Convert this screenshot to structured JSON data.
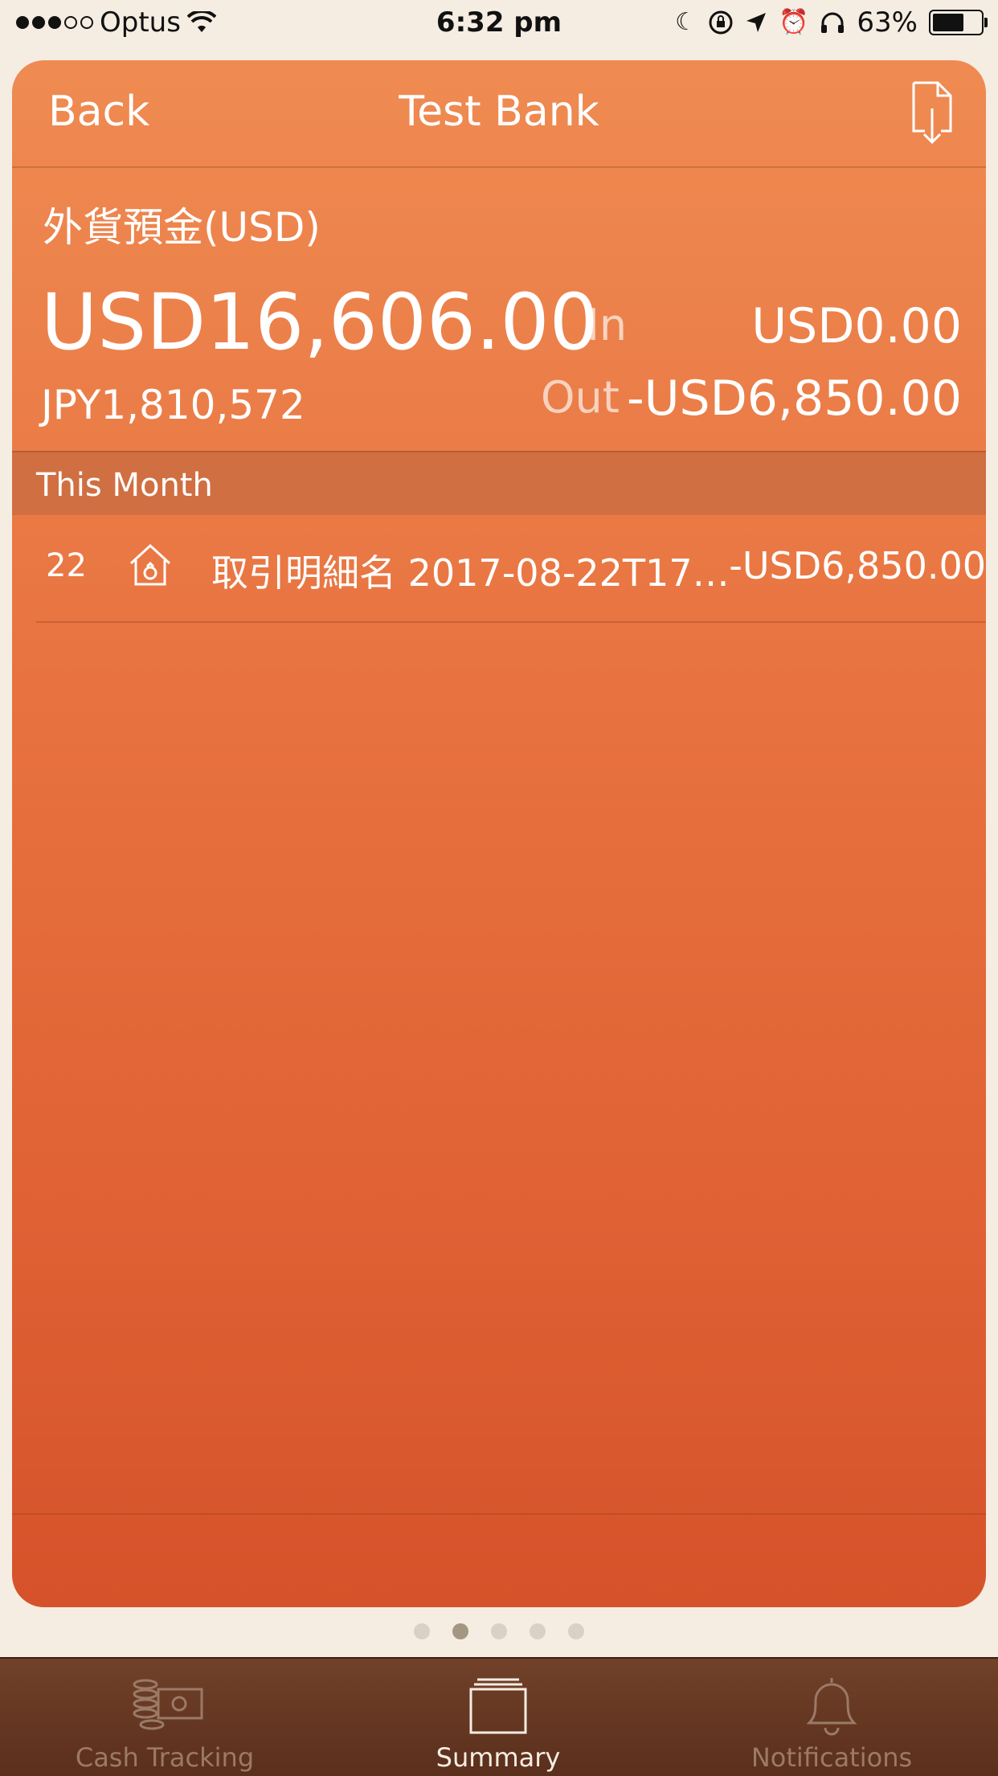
{
  "status_bar": {
    "carrier": "Optus",
    "time": "6:32 pm",
    "battery": "63%"
  },
  "nav": {
    "back_label": "Back",
    "title": "Test Bank"
  },
  "account": {
    "name": "外貨預金(USD)",
    "balance": "USD16,606.00",
    "balance_jpy": "JPY1,810,572",
    "in_label": "In",
    "in_value": "USD0.00",
    "out_label": "Out",
    "out_value": "-USD6,850.00"
  },
  "section": {
    "title": "This Month"
  },
  "transactions": [
    {
      "day": "22",
      "name": "取引明細名 2017-08-22T17…",
      "amount": "-USD6,850.00"
    }
  ],
  "pager": {
    "pages": 5,
    "active_index": 1
  },
  "tabs": [
    {
      "label": "Cash Tracking"
    },
    {
      "label": "Summary"
    },
    {
      "label": "Notifications"
    }
  ],
  "colors": {
    "card_top": "#ef8b52",
    "card_bottom": "#d6522a",
    "tabbar": "#5a2f1c",
    "background": "#f5ede2"
  }
}
